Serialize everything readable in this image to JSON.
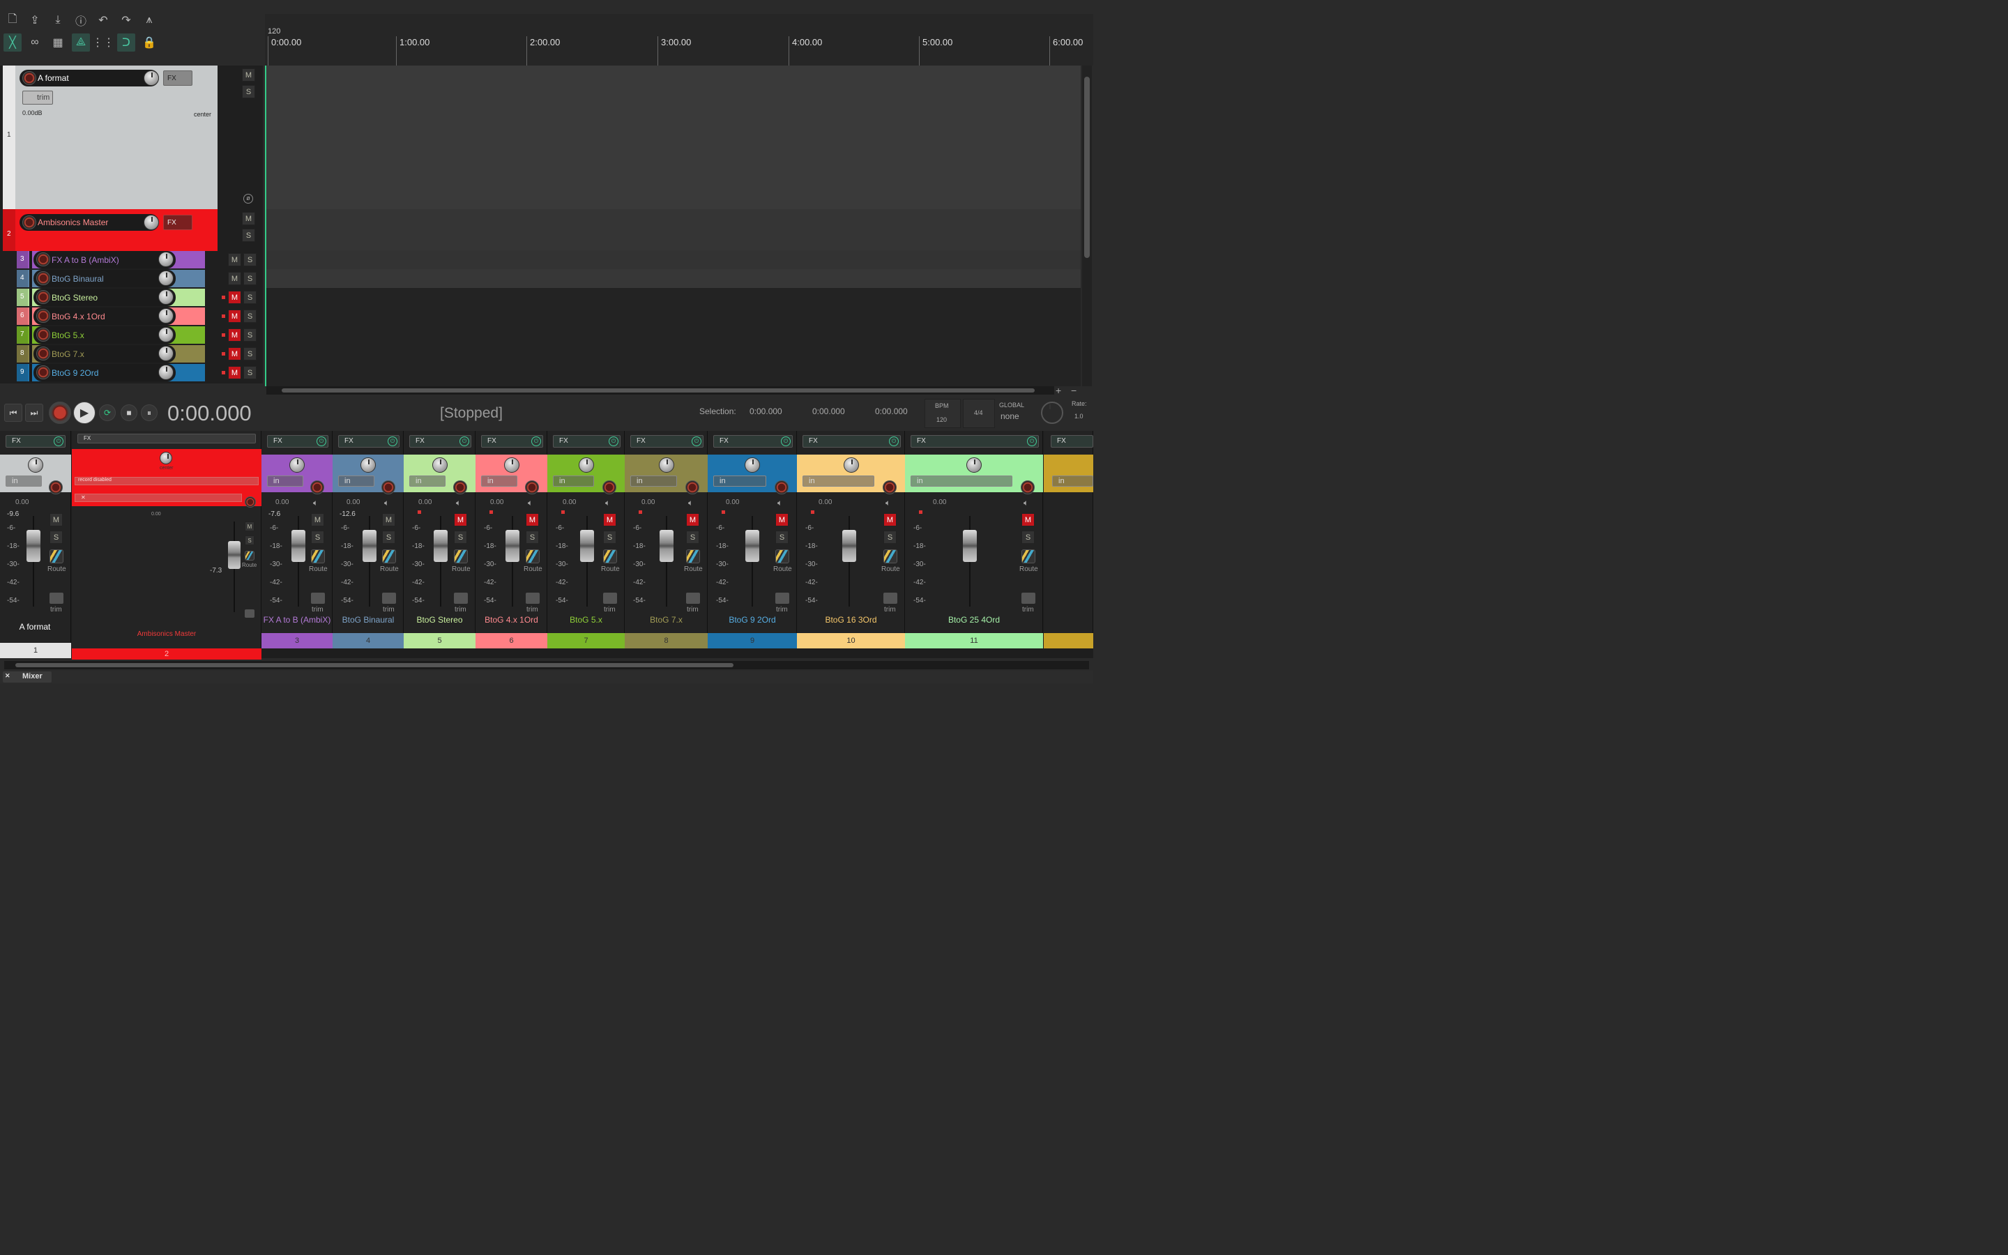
{
  "toolbar": {
    "row1": [
      "new-project",
      "open-project",
      "save-project",
      "project-info",
      "undo",
      "redo",
      "metronome"
    ],
    "row2": [
      "ripple-edit",
      "link",
      "grid",
      "snap-link",
      "grid-lines",
      "snap",
      "lock"
    ]
  },
  "ruler": {
    "bpm": "120",
    "marks": [
      "0:00.00",
      "1:00.00",
      "2:00.00",
      "3:00.00",
      "4:00.00",
      "5:00.00",
      "6:00.00"
    ]
  },
  "tracks": {
    "t1": {
      "num": "1",
      "name": "A format",
      "fx": "FX",
      "trim": "trim",
      "vol": "0.00dB",
      "pan": "center"
    },
    "t2": {
      "num": "2",
      "name": "Ambisonics Master",
      "fx": "FX"
    },
    "small": [
      {
        "num": "3",
        "name": "FX A to B (AmbiX)",
        "color": "#9b58c2",
        "text": "#b37ad6",
        "mute": false
      },
      {
        "num": "4",
        "name": "BtoG Binaural",
        "color": "#5d84a8",
        "text": "#7ea3c8",
        "mute": false
      },
      {
        "num": "5",
        "name": "BtoG Stereo",
        "color": "#b8e79a",
        "text": "#c9ef9e",
        "mute": true
      },
      {
        "num": "6",
        "name": "BtoG 4.x 1Ord",
        "color": "#ff7f84",
        "text": "#ff8a8f",
        "mute": true
      },
      {
        "num": "7",
        "name": "BtoG 5.x",
        "color": "#7ab828",
        "text": "#8fd038",
        "mute": true
      },
      {
        "num": "8",
        "name": "BtoG 7.x",
        "color": "#8c8648",
        "text": "#a29c56",
        "mute": true
      },
      {
        "num": "9",
        "name": "BtoG 9 2Ord",
        "color": "#1e74ac",
        "text": "#57aee3",
        "mute": true
      }
    ],
    "m": "M",
    "s": "S"
  },
  "transport": {
    "time": "0:00.000",
    "status": "[Stopped]",
    "selection_label": "Selection:",
    "sel_start": "0:00.000",
    "sel_end": "0:00.000",
    "sel_len": "0:00.000",
    "bpm_label": "BPM",
    "bpm": "120",
    "timesig": "4/4",
    "global_label": "GLOBAL",
    "global_value": "none",
    "rate_label": "Rate:",
    "rate": "1.0"
  },
  "mixer": {
    "fx": "FX",
    "in": "in",
    "route": "Route",
    "trim": "trim",
    "scale": [
      "-6-",
      "-18-",
      "-30-",
      "-42-",
      "-54-"
    ],
    "master": {
      "name": "Ambisonics Master",
      "num": "2",
      "pan": "center",
      "rec": "record disabled",
      "vol": "0.00",
      "peak": "-7.3"
    },
    "first": {
      "name": "A format",
      "num": "1",
      "vol": "0.00",
      "peak": "-9.6"
    },
    "strips": [
      {
        "name": "FX A to B (AmbiX)",
        "num": "3",
        "color": "#9b58c2",
        "text": "#b37ad6",
        "peak": "-7.6",
        "vol": "0.00",
        "mute": false
      },
      {
        "name": "BtoG Binaural",
        "num": "4",
        "color": "#5d84a8",
        "text": "#7ea3c8",
        "peak": "-12.6",
        "vol": "0.00",
        "mute": false
      },
      {
        "name": "BtoG Stereo",
        "num": "5",
        "color": "#b8e79a",
        "text": "#c9ef9e",
        "peak": "",
        "vol": "0.00",
        "mute": true
      },
      {
        "name": "BtoG 4.x 1Ord",
        "num": "6",
        "color": "#ff7f84",
        "text": "#ff8a8f",
        "peak": "",
        "vol": "0.00",
        "mute": true
      },
      {
        "name": "BtoG 5.x",
        "num": "7",
        "color": "#7ab828",
        "text": "#8fd038",
        "peak": "",
        "vol": "0.00",
        "mute": true
      },
      {
        "name": "BtoG 7.x",
        "num": "8",
        "color": "#8c8648",
        "text": "#a29c56",
        "peak": "",
        "vol": "0.00",
        "mute": true
      },
      {
        "name": "BtoG 9 2Ord",
        "num": "9",
        "color": "#1e74ac",
        "text": "#57aee3",
        "peak": "",
        "vol": "0.00",
        "mute": true
      },
      {
        "name": "BtoG 16 3Ord",
        "num": "10",
        "color": "#f9cf7d",
        "text": "#f4c66a",
        "peak": "",
        "vol": "0.00",
        "mute": true
      },
      {
        "name": "BtoG 25 4Ord",
        "num": "11",
        "color": "#9eeea0",
        "text": "#a5f0a8",
        "peak": "",
        "vol": "0.00",
        "mute": true
      }
    ],
    "tab": "Mixer"
  }
}
